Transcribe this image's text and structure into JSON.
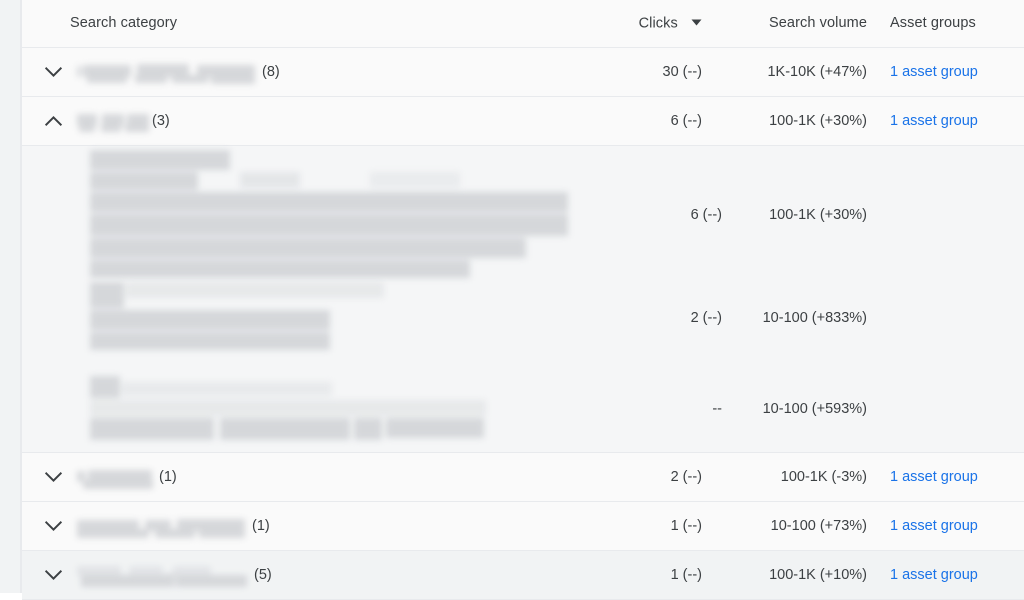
{
  "table": {
    "columns": {
      "category": "Search category",
      "clicks": "Clicks",
      "clicks_sort_icon": "sort-descending-arrow-icon",
      "search_volume": "Search volume",
      "asset_groups": "Asset groups"
    },
    "rows": [
      {
        "id": "row-1",
        "expanded": false,
        "toggle_icon": "chevron-down-icon",
        "category_redacted": true,
        "count": "(8)",
        "clicks": "30 (--)",
        "search_volume": "1K-10K (+47%)",
        "asset_groups": "1 asset group",
        "hovered": false
      },
      {
        "id": "row-2",
        "expanded": true,
        "toggle_icon": "chevron-up-icon",
        "category_redacted": true,
        "count": "(3)",
        "clicks": "6 (--)",
        "search_volume": "100-1K (+30%)",
        "asset_groups": "1 asset group",
        "hovered": false,
        "children": [
          {
            "id": "child-1",
            "term_redacted": true,
            "clicks": "6 (--)",
            "search_volume": "100-1K (+30%)"
          },
          {
            "id": "child-2",
            "term_redacted": true,
            "clicks": "2 (--)",
            "search_volume": "10-100 (+833%)"
          },
          {
            "id": "child-3",
            "term_redacted": true,
            "clicks": "--",
            "search_volume": "10-100 (+593%)"
          }
        ]
      },
      {
        "id": "row-3",
        "expanded": false,
        "toggle_icon": "chevron-down-icon",
        "category_redacted": true,
        "count": "(1)",
        "clicks": "2 (--)",
        "search_volume": "100-1K (-3%)",
        "asset_groups": "1 asset group",
        "hovered": false
      },
      {
        "id": "row-4",
        "expanded": false,
        "toggle_icon": "chevron-down-icon",
        "category_redacted": true,
        "count": "(1)",
        "clicks": "1 (--)",
        "search_volume": "10-100 (+73%)",
        "asset_groups": "1 asset group",
        "hovered": false
      },
      {
        "id": "row-5",
        "expanded": false,
        "toggle_icon": "chevron-down-icon",
        "category_redacted": true,
        "count": "(5)",
        "clicks": "1 (--)",
        "search_volume": "100-1K (+10%)",
        "asset_groups": "1 asset group",
        "hovered": true
      }
    ]
  },
  "colors": {
    "link": "#1a73e8",
    "text": "#3c4043",
    "row_background": "#fafafa",
    "row_hover_background": "#f1f3f4",
    "expanded_background": "#f5f6f7",
    "border": "#e8eaed"
  }
}
